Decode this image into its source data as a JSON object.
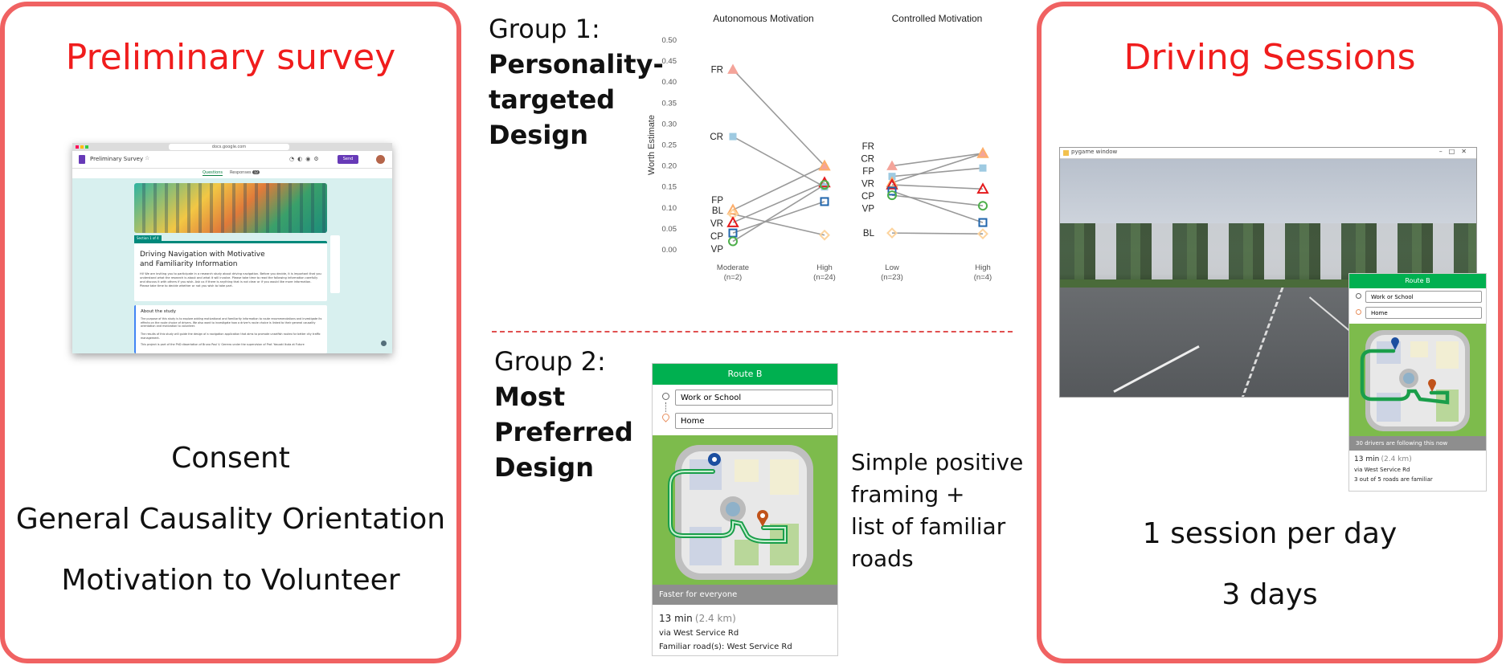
{
  "left": {
    "title": "Preliminary survey",
    "form": {
      "url": "docs.google.com",
      "doc_title": "Preliminary Survey",
      "send_label": "Send",
      "tab_questions": "Questions",
      "tab_responses": "Responses",
      "responses_count": "12",
      "section_label": "Section 1 of 4",
      "form_title": "Driving Navigation with Motivative and Familiarity Information",
      "intro": "Hi! We are inviting you to participate in a research study about driving navigation. Before you decide, it is important that you understand what the research is about and what it will involve. Please take time to read the following information carefully and discuss it with others if you wish. Ask us if there is anything that is not clear or if you would like more information. Please take time to decide whether or not you wish to take part.",
      "about_heading": "About the study",
      "about_p1": "The purpose of this study is to explore adding motivational and familiarity information to route recommendations and investigate its effects on the route choice of drivers. We also want to investigate how a driver's route choice is linked to their general causality orientation and motivation to volunteer.",
      "about_p2": "The results of this study will guide the design of a navigation application that aims to promote unselfish routes for better city traffic management.",
      "about_p3": "This project is part of the PhD dissertation of Bruno Paul V. Gerrero under the supervision of Prof. Yasuaki Ikuta at Future"
    },
    "items": [
      "Consent",
      "General Causality Orientation",
      "Motivation to Volunteer"
    ]
  },
  "middle": {
    "group1": {
      "line1": "Group 1:",
      "line2": "Personality-",
      "line3": "targeted",
      "line4": "Design"
    },
    "group2": {
      "line1": "Group 2:",
      "line2": "Most",
      "line3": "Preferred",
      "line4": "Design"
    },
    "route_card": {
      "header": "Route B",
      "origin": "Work or School",
      "destination": "Home",
      "band": "Faster for everyone",
      "time": "13 min",
      "distance": "(2.4 km)",
      "via": "via West Service Rd",
      "familiar": "Familiar road(s): West Service Rd"
    },
    "caption": [
      "Simple positive",
      "framing +",
      "list of familiar",
      "roads"
    ]
  },
  "right": {
    "title": "Driving Sessions",
    "window_title": "pygame window",
    "route_card": {
      "header": "Route B",
      "origin": "Work or School",
      "destination": "Home",
      "band": "30 drivers are following this now",
      "time": "13 min",
      "distance": "(2.4 km)",
      "via": "via West Service Rd",
      "familiar": "3 out of 5 roads are familiar"
    },
    "items": [
      "1 session per day",
      "3 days"
    ]
  },
  "chart_data": {
    "type": "line",
    "ylabel": "Worth Estimate",
    "ylim": [
      0,
      0.5
    ],
    "yticks": [
      "0.00",
      "0.05",
      "0.10",
      "0.15",
      "0.20",
      "0.25",
      "0.30",
      "0.35",
      "0.40",
      "0.45",
      "0.50"
    ],
    "panels": [
      {
        "title": "Autonomous Motivation",
        "categories": [
          "Moderate\n(n=2)",
          "High\n(n=24)"
        ],
        "series": [
          {
            "name": "FR",
            "values": [
              0.43,
              0.2
            ],
            "color": "#f4a49a",
            "marker": "triangle-filled"
          },
          {
            "name": "CR",
            "values": [
              0.27,
              0.15
            ],
            "color": "#9ecae1",
            "marker": "square-filled"
          },
          {
            "name": "FP",
            "values": [
              0.095,
              0.2
            ],
            "color": "#fdae6b",
            "marker": "triangle-open"
          },
          {
            "name": "BL",
            "values": [
              0.085,
              0.035
            ],
            "color": "#fdd49e",
            "marker": "diamond-open"
          },
          {
            "name": "VR",
            "values": [
              0.065,
              0.16
            ],
            "color": "#e41a1c",
            "marker": "triangle-open-red"
          },
          {
            "name": "CP",
            "values": [
              0.04,
              0.115
            ],
            "color": "#2166ac",
            "marker": "square-open"
          },
          {
            "name": "VP",
            "values": [
              0.02,
              0.155
            ],
            "color": "#4daf4a",
            "marker": "circle-open"
          }
        ]
      },
      {
        "title": "Controlled Motivation",
        "categories": [
          "Low\n(n=23)",
          "High\n(n=4)"
        ],
        "series": [
          {
            "name": "FR",
            "values": [
              0.2,
              0.23
            ],
            "color": "#f4a49a",
            "marker": "triangle-filled"
          },
          {
            "name": "CR",
            "values": [
              0.175,
              0.195
            ],
            "color": "#9ecae1",
            "marker": "square-filled"
          },
          {
            "name": "FP",
            "values": [
              0.16,
              0.23
            ],
            "color": "#fdae6b",
            "marker": "triangle-open"
          },
          {
            "name": "VR",
            "values": [
              0.155,
              0.145
            ],
            "color": "#e41a1c",
            "marker": "triangle-open-red"
          },
          {
            "name": "CP",
            "values": [
              0.14,
              0.065
            ],
            "color": "#2166ac",
            "marker": "square-open"
          },
          {
            "name": "VP",
            "values": [
              0.13,
              0.105
            ],
            "color": "#4daf4a",
            "marker": "circle-open"
          },
          {
            "name": "BL",
            "values": [
              0.04,
              0.038
            ],
            "color": "#fdd49e",
            "marker": "diamond-open"
          }
        ]
      }
    ]
  }
}
